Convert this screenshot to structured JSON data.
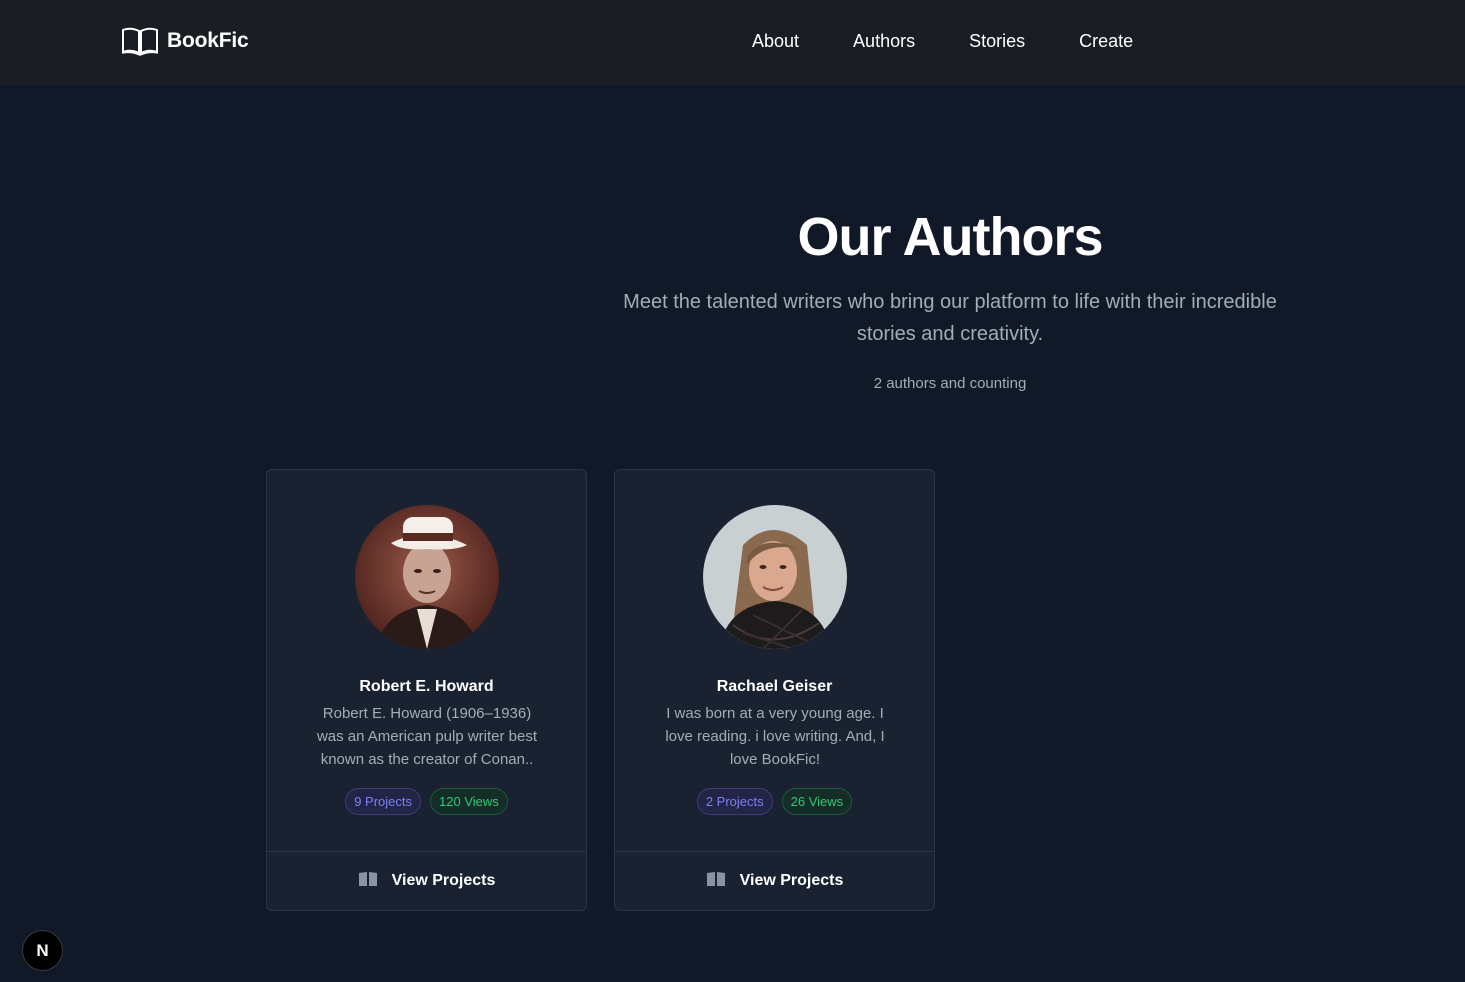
{
  "header": {
    "brand": "BookFic",
    "nav": [
      "About",
      "Authors",
      "Stories",
      "Create"
    ]
  },
  "hero": {
    "title": "Our Authors",
    "subtitle_line1": "Meet the talented writers who bring our platform to life with their incredible",
    "subtitle_line2": "stories and creativity.",
    "count": "2 authors and counting"
  },
  "authors": [
    {
      "name": "Robert E. Howard",
      "bio_lines": [
        "Robert E. Howard (1906–1936)",
        "was an American pulp writer best",
        "known as the creator of Conan.."
      ],
      "projects": "9 Projects",
      "views": "120 Views",
      "action": "View Projects"
    },
    {
      "name": "Rachael Geiser",
      "bio_lines": [
        "I was born at a very young age. I",
        "love reading. i love writing. And, I",
        "love BookFic!"
      ],
      "projects": "2 Projects",
      "views": "26 Views",
      "action": "View Projects"
    }
  ],
  "devtools": {
    "badge": "N"
  },
  "colors": {
    "background": "#111827",
    "header": "#1a1e24",
    "card": "#1a2232",
    "projects_badge": "#7b82f5",
    "views_badge": "#34c77a"
  }
}
